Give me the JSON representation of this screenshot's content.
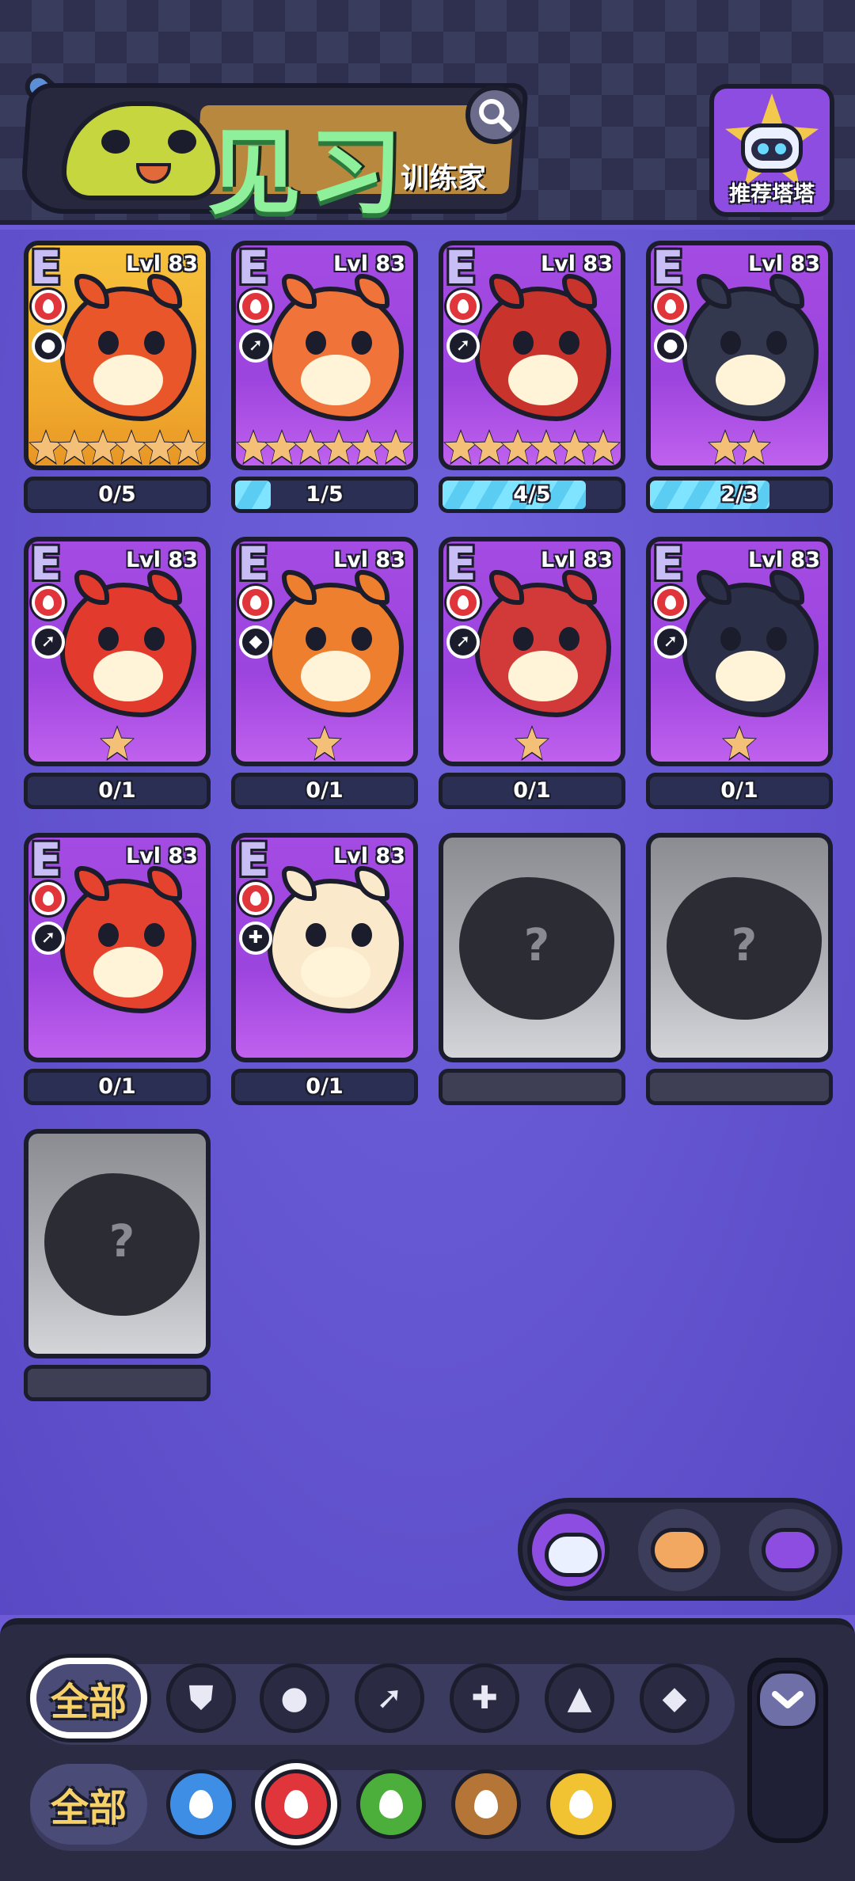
{
  "header": {
    "title": "见习",
    "subtitle": "训练家",
    "recommend_label": "推荐塔塔"
  },
  "cards": [
    {
      "rank": "E",
      "level": "Lvl 83",
      "progress_text": "0/5",
      "progress": 0.0,
      "stars": 6,
      "role_icon": "bust-icon",
      "bg": "gold",
      "color": "#e8562a"
    },
    {
      "rank": "E",
      "level": "Lvl 83",
      "progress_text": "1/5",
      "progress": 0.2,
      "stars": 6,
      "role_icon": "dash-icon",
      "bg": "purple",
      "color": "#f0733a"
    },
    {
      "rank": "E",
      "level": "Lvl 83",
      "progress_text": "4/5",
      "progress": 0.8,
      "stars": 6,
      "role_icon": "dash-icon",
      "bg": "purple",
      "color": "#c8342c"
    },
    {
      "rank": "E",
      "level": "Lvl 83",
      "progress_text": "2/3",
      "progress": 0.67,
      "stars": 2,
      "role_icon": "bust-icon",
      "bg": "purple",
      "color": "#34384e"
    },
    {
      "rank": "E",
      "level": "Lvl 83",
      "progress_text": "0/1",
      "progress": 0.0,
      "stars": 1,
      "role_icon": "dash-icon",
      "bg": "purple",
      "color": "#e23b2e"
    },
    {
      "rank": "E",
      "level": "Lvl 83",
      "progress_text": "0/1",
      "progress": 0.0,
      "stars": 1,
      "role_icon": "diamond-icon",
      "bg": "purple",
      "color": "#ee7f2f"
    },
    {
      "rank": "E",
      "level": "Lvl 83",
      "progress_text": "0/1",
      "progress": 0.0,
      "stars": 1,
      "role_icon": "dash-icon",
      "bg": "purple",
      "color": "#d23a3a"
    },
    {
      "rank": "E",
      "level": "Lvl 83",
      "progress_text": "0/1",
      "progress": 0.0,
      "stars": 1,
      "role_icon": "dash-icon",
      "bg": "purple",
      "color": "#2c2f48"
    },
    {
      "rank": "E",
      "level": "Lvl 83",
      "progress_text": "0/1",
      "progress": 0.0,
      "stars": 0,
      "role_icon": "dash-icon",
      "bg": "purple",
      "color": "#e5432e"
    },
    {
      "rank": "E",
      "level": "Lvl 83",
      "progress_text": "0/1",
      "progress": 0.0,
      "stars": 0,
      "role_icon": "cross-icon",
      "bg": "purple",
      "color": "#fbe9cc"
    }
  ],
  "locked_cards": [
    {
      "label": "?"
    },
    {
      "label": "?"
    },
    {
      "label": "?"
    }
  ],
  "filters": {
    "all_label_roles": "全部",
    "all_label_elements": "全部",
    "role_icons": [
      "shield-icon",
      "bust-icon",
      "dash-icon",
      "cross-icon",
      "flask-icon",
      "diamond-icon"
    ],
    "element_icons": [
      {
        "name": "water-icon",
        "color": "#3f8ee6"
      },
      {
        "name": "fire-icon",
        "color": "#e0353b"
      },
      {
        "name": "leaf-icon",
        "color": "#4caf3c"
      },
      {
        "name": "earth-icon",
        "color": "#b57536"
      },
      {
        "name": "lightning-icon",
        "color": "#f1c232"
      }
    ],
    "selected_element": "fire-icon"
  },
  "colors": {
    "accent": "#8d4de0",
    "fire": "#e0353b",
    "progress": "#7fe4ff",
    "gold_label": "#f6d16a"
  }
}
